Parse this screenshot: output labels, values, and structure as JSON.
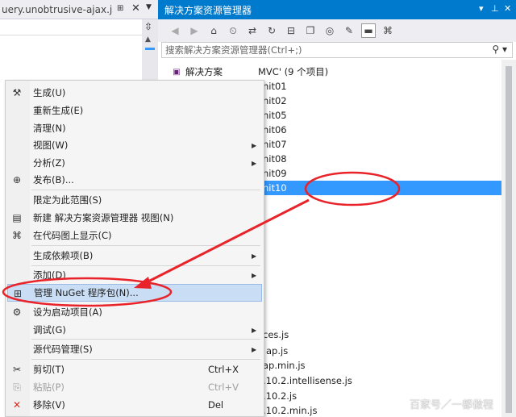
{
  "editor": {
    "tab_title": "uery.unobtrusive-ajax.js",
    "pin": "⊞",
    "close": "✕",
    "dropdown": "▼"
  },
  "explorer": {
    "title": "解决方案资源管理器",
    "pin": "▾",
    "autohide": "⊥",
    "close": "✕",
    "search_placeholder": "搜索解决方案资源管理器(Ctrl+;)",
    "tree": [
      {
        "text": "解决方案",
        "icon": "solution-icon",
        "selected": false
      },
      {
        "text": "MVC' (9 个项目)",
        "icon": "",
        "selected": false
      },
      {
        "text": "nit01",
        "icon": "",
        "selected": false
      },
      {
        "text": "nit02",
        "icon": "",
        "selected": false
      },
      {
        "text": "nit05",
        "icon": "",
        "selected": false
      },
      {
        "text": "nit06",
        "icon": "",
        "selected": false
      },
      {
        "text": "nit07",
        "icon": "",
        "selected": false
      },
      {
        "text": "nit08",
        "icon": "",
        "selected": false
      },
      {
        "text": "nit09",
        "icon": "",
        "selected": false
      },
      {
        "text": "nit10",
        "icon": "",
        "selected": true
      },
      {
        "text": "ces.js",
        "icon": "",
        "selected": false
      },
      {
        "text": "ap.js",
        "icon": "",
        "selected": false
      },
      {
        "text": "ap.min.js",
        "icon": "",
        "selected": false
      },
      {
        "text": ".10.2.intellisense.js",
        "icon": "",
        "selected": false
      },
      {
        "text": ".10.2.js",
        "icon": "",
        "selected": false
      },
      {
        "text": ".10.2.min.js",
        "icon": "",
        "selected": false
      }
    ]
  },
  "menu": {
    "items": [
      {
        "label": "生成(U)",
        "icon": "build-icon",
        "glyph": "⚒",
        "shortcut": "",
        "submenu": false,
        "disabled": false,
        "highlight": false
      },
      {
        "label": "重新生成(E)",
        "icon": "",
        "glyph": "",
        "shortcut": "",
        "submenu": false,
        "disabled": false,
        "highlight": false
      },
      {
        "label": "清理(N)",
        "icon": "",
        "glyph": "",
        "shortcut": "",
        "submenu": false,
        "disabled": false,
        "highlight": false
      },
      {
        "label": "视图(W)",
        "icon": "",
        "glyph": "",
        "shortcut": "",
        "submenu": true,
        "disabled": false,
        "highlight": false
      },
      {
        "label": "分析(Z)",
        "icon": "",
        "glyph": "",
        "shortcut": "",
        "submenu": true,
        "disabled": false,
        "highlight": false
      },
      {
        "label": "发布(B)...",
        "icon": "publish-icon",
        "glyph": "⊕",
        "shortcut": "",
        "submenu": false,
        "disabled": false,
        "highlight": false
      },
      {
        "label": "限定为此范围(S)",
        "icon": "",
        "glyph": "",
        "shortcut": "",
        "submenu": false,
        "disabled": false,
        "highlight": false
      },
      {
        "label": "新建 解决方案资源管理器 视图(N)",
        "icon": "new-view-icon",
        "glyph": "▤",
        "shortcut": "",
        "submenu": false,
        "disabled": false,
        "highlight": false
      },
      {
        "label": "在代码图上显示(C)",
        "icon": "code-map-icon",
        "glyph": "⌘",
        "shortcut": "",
        "submenu": false,
        "disabled": false,
        "highlight": false
      },
      {
        "label": "生成依赖项(B)",
        "icon": "",
        "glyph": "",
        "shortcut": "",
        "submenu": true,
        "disabled": false,
        "highlight": false
      },
      {
        "label": "添加(D)",
        "icon": "",
        "glyph": "",
        "shortcut": "",
        "submenu": true,
        "disabled": false,
        "highlight": false
      },
      {
        "label": "管理 NuGet 程序包(N)...",
        "icon": "nuget-icon",
        "glyph": "⊞",
        "shortcut": "",
        "submenu": false,
        "disabled": false,
        "highlight": true
      },
      {
        "label": "设为启动项目(A)",
        "icon": "gear-icon",
        "glyph": "⚙",
        "shortcut": "",
        "submenu": false,
        "disabled": false,
        "highlight": false
      },
      {
        "label": "调试(G)",
        "icon": "",
        "glyph": "",
        "shortcut": "",
        "submenu": true,
        "disabled": false,
        "highlight": false
      },
      {
        "label": "源代码管理(S)",
        "icon": "",
        "glyph": "",
        "shortcut": "",
        "submenu": true,
        "disabled": false,
        "highlight": false
      },
      {
        "label": "剪切(T)",
        "icon": "cut-icon",
        "glyph": "✂",
        "shortcut": "Ctrl+X",
        "submenu": false,
        "disabled": false,
        "highlight": false
      },
      {
        "label": "粘贴(P)",
        "icon": "paste-icon",
        "glyph": "⎘",
        "shortcut": "Ctrl+V",
        "submenu": false,
        "disabled": true,
        "highlight": false
      },
      {
        "label": "移除(V)",
        "icon": "remove-icon",
        "glyph": "✕",
        "shortcut": "Del",
        "submenu": false,
        "disabled": false,
        "highlight": false
      }
    ]
  },
  "watermark": "百家号／一都做程",
  "colors": {
    "accent": "#007acc",
    "selection": "#3399ff",
    "annotation": "#e8232a"
  }
}
